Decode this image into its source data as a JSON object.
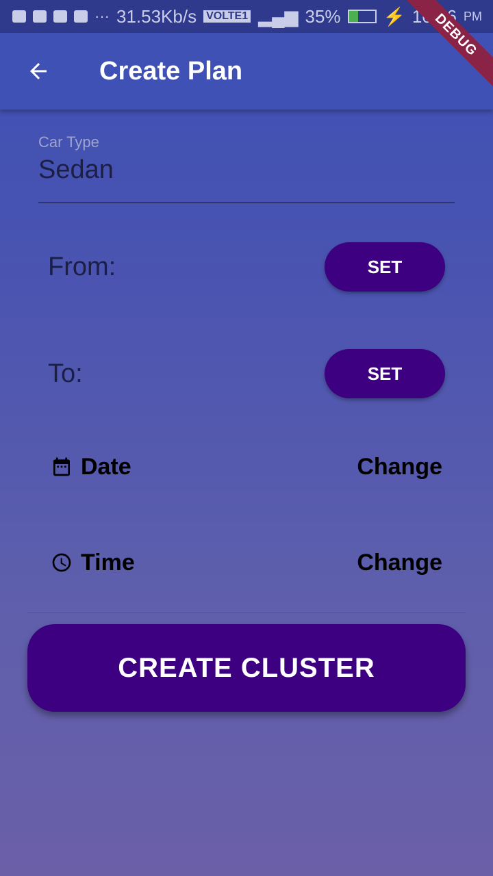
{
  "status_bar": {
    "speed": "31.53Kb/s",
    "network": "VOLTE1",
    "battery": "35%",
    "time": "10:46",
    "ampm": "PM"
  },
  "app_bar": {
    "title": "Create Plan",
    "back_icon": "arrow-back-icon"
  },
  "debug_banner": "DEBUG",
  "car_type": {
    "label": "Car Type",
    "value": "Sedan"
  },
  "from": {
    "label": "From:",
    "button": "SET"
  },
  "to": {
    "label": "To:",
    "button": "SET"
  },
  "date": {
    "icon": "calendar-icon",
    "label": "Date",
    "action": "Change"
  },
  "time": {
    "icon": "clock-icon",
    "label": "Time",
    "action": "Change"
  },
  "create_button": "CREATE CLUSTER",
  "colors": {
    "app_bar": "#3f51b5",
    "button": "#3d0080",
    "debug": "#8b2346"
  }
}
